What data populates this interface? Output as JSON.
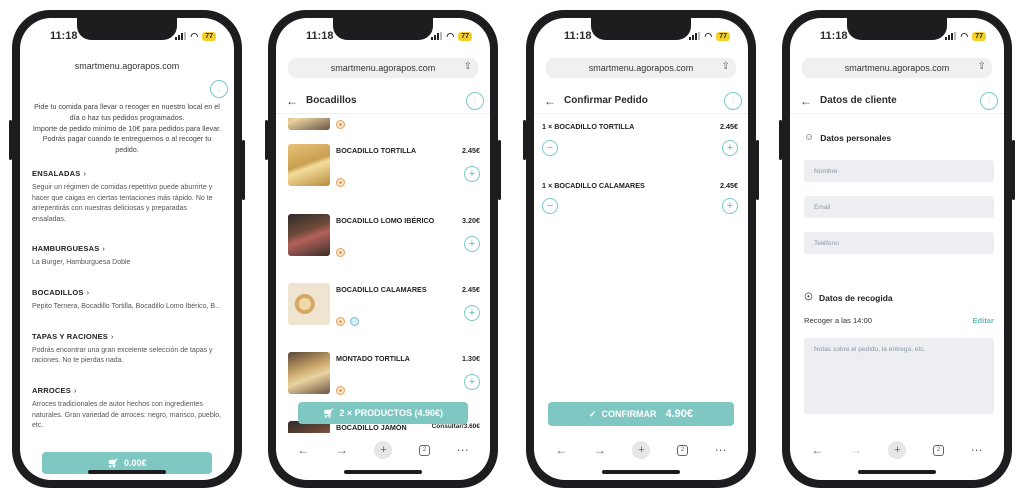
{
  "status": {
    "time": "11:18",
    "battery": "77"
  },
  "phone1": {
    "url": "smartmenu.agorapos.com",
    "intro": "Pide tu comida para llevar o recoger en nuestro local en el día o haz tus pedidos programados.",
    "intro2": "Importe de pedido mínimo de 10€ para pedidos para llevar. Podrás pagar cuando te entreguemos o al recoger tu pedido.",
    "sections": [
      {
        "title": "ENSALADAS",
        "desc": "Seguir un régimen de comidas repetitivo puede aburrirte y hacer que caigas en ciertas tentaciones más rápido. No te arrepentirás con nuestras deliciosas y preparadas ensaladas."
      },
      {
        "title": "HAMBURGUESAS",
        "desc": "La Burger, Hamburguesa Doble"
      },
      {
        "title": "BOCADILLOS",
        "desc": "Pepito Ternera, Bocadillo Tortilla, Bocadillo Lomo Ibérico, B..."
      },
      {
        "title": "TAPAS Y RACIONES",
        "desc": "Podrás encontrar una gran excelente selección de tapas y raciones. No te pierdas nada."
      },
      {
        "title": "ARROCES",
        "desc": "Arroces tradicionales de autor hechos con ingredientes naturales. Gran variedad de arroces: negro, marisco, pueblo, etc."
      }
    ],
    "cart_label": "0.00€"
  },
  "phone2": {
    "url": "smartmenu.agorapos.com",
    "header": "Bocadillos",
    "products": [
      {
        "name": "BOCADILLO TORTILLA",
        "price": "2.45€"
      },
      {
        "name": "BOCADILLO LOMO IBÉRICO",
        "price": "3.20€"
      },
      {
        "name": "BOCADILLO CALAMARES",
        "price": "2.45€"
      },
      {
        "name": "MONTADO TORTILLA",
        "price": "1.30€"
      }
    ],
    "partial_name": "BOCADILLO JAMÓN",
    "partial_price": "Consultar/3.60€",
    "cart_label": "2 × PRODUCTOS (4.90€)"
  },
  "phone3": {
    "url": "smartmenu.agorapos.com",
    "header": "Confirmar Pedido",
    "lines": [
      {
        "label": "1 × BOCADILLO TORTILLA",
        "price": "2.45€"
      },
      {
        "label": "1 × BOCADILLO CALAMARES",
        "price": "2.45€"
      }
    ],
    "confirm_label": "CONFIRMAR",
    "confirm_total": "4.90€"
  },
  "phone4": {
    "url": "smartmenu.agorapos.com",
    "header": "Datos de cliente",
    "personal_title": "Datos personales",
    "fields": {
      "name": "Nombre",
      "email": "Email",
      "phone": "Teléfono"
    },
    "pickup_title": "Datos de recogida",
    "pickup_time": "Recoger a las 14:00",
    "edit_label": "Editar",
    "notes_placeholder": "Notas sobre el pedido, la entrega, etc."
  },
  "colors": {
    "accent": "#7fc7c3",
    "field_bg": "#eceef1"
  }
}
